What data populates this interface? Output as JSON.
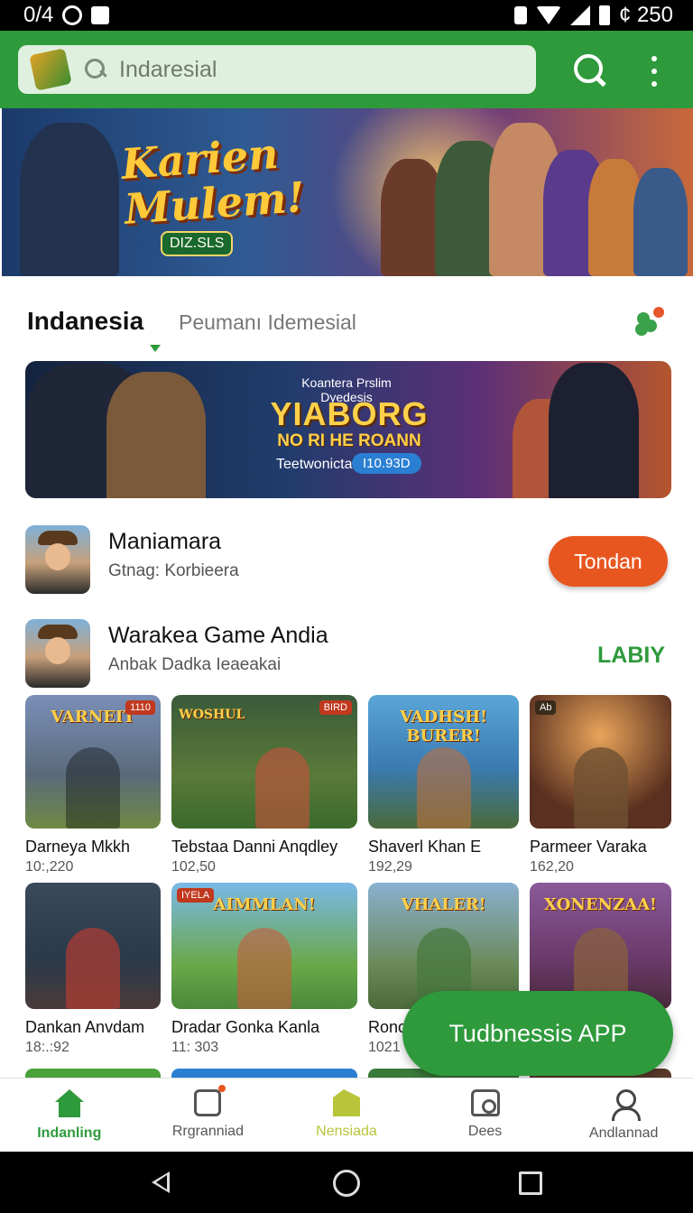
{
  "status_bar": {
    "time": "0/4",
    "right_text": "¢ 250"
  },
  "header": {
    "search_placeholder": "Indaresial",
    "icons": [
      "app-logo-icon",
      "search-icon",
      "more-vert-icon"
    ],
    "accent": "#2e9a3c"
  },
  "hero_banner": {
    "title_line1": "Karien",
    "title_line2": "Mulem!",
    "tag": "DIZ.SLS"
  },
  "section_tabs": {
    "active": "Indanesia",
    "other": "Peumanı Idemesial"
  },
  "promo_banner": {
    "subtitle": "Koantera Prslim Dyedesis",
    "title": "YIABORG",
    "line2": "NO RI HE ROANN",
    "label": "Teetwonicta",
    "chip": "I10.93D"
  },
  "rows": [
    {
      "title": "Maniamara",
      "subtitle": "Gtnag: Korbieera",
      "button": "Tondan"
    },
    {
      "title": "Warakea Game Andia",
      "subtitle": "Anbak Dadka Ieaeakai",
      "link": "LABIY"
    }
  ],
  "games": [
    {
      "name": "Darneya Mkkh",
      "count": "10:,220",
      "badge": "1110",
      "logo": "VARNEIT"
    },
    {
      "name": "Tebstaa Danni Anqdley",
      "count": "102,50",
      "badge": "BIRD",
      "logo": "WOSHUL"
    },
    {
      "name": "Shaverl Khan E",
      "count": "192,29",
      "badge": "",
      "logo": "VADHSH! BURER!"
    },
    {
      "name": "Parmeer Varaka",
      "count": "162,20",
      "badge": "Ab",
      "logo": ""
    },
    {
      "name": "Dankan Anvdam",
      "count": "18:.:92",
      "badge": "",
      "logo": ""
    },
    {
      "name": "Dradar Gonka Kanla",
      "count": "11: 303",
      "badge": "IYELA",
      "logo": "AIMMLAN!"
    },
    {
      "name": "Ronc",
      "count": "1021",
      "badge": "",
      "logo": "VHALER!"
    },
    {
      "name": "",
      "count": "",
      "badge": "",
      "logo": "XONENZAA!"
    }
  ],
  "fab": {
    "label": "Tudbnessis APP"
  },
  "bottom_nav": [
    {
      "label": "Indanling",
      "icon": "home-icon",
      "active": true
    },
    {
      "label": "Rrgranniad",
      "icon": "library-icon"
    },
    {
      "label": "Nensiada",
      "icon": "tag-icon"
    },
    {
      "label": "Dees",
      "icon": "device-icon"
    },
    {
      "label": "Andlannad",
      "icon": "account-icon"
    }
  ],
  "colors": {
    "brand_green": "#2e9a3c",
    "install_orange": "#e8561f",
    "highlight_yellow": "#b8c53a"
  }
}
